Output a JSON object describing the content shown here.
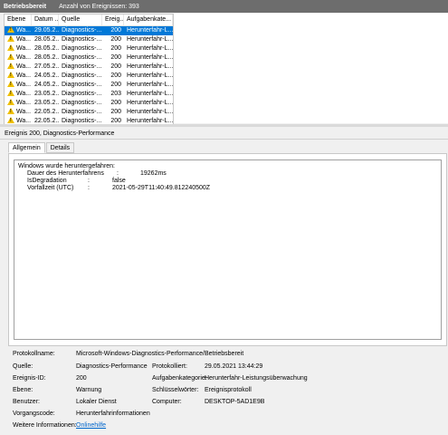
{
  "topbar": {
    "title": "Betriebsbereit",
    "count_label": "Anzahl von Ereignissen: 393"
  },
  "list": {
    "columns": [
      "Ebene",
      "Datum ...",
      "Quelle",
      "Ereig...",
      "Aufgabenkate..."
    ],
    "rows": [
      {
        "level": "Wa...",
        "date": "29.05.2...",
        "source": "Diagnostics-...",
        "id": "200",
        "task": "Herunterfahr-L...",
        "selected": true
      },
      {
        "level": "Wa...",
        "date": "28.05.2...",
        "source": "Diagnostics-...",
        "id": "200",
        "task": "Herunterfahr-L..."
      },
      {
        "level": "Wa...",
        "date": "28.05.2...",
        "source": "Diagnostics-...",
        "id": "200",
        "task": "Herunterfahr-L..."
      },
      {
        "level": "Wa...",
        "date": "28.05.2...",
        "source": "Diagnostics-...",
        "id": "200",
        "task": "Herunterfahr-L..."
      },
      {
        "level": "Wa...",
        "date": "27.05.2...",
        "source": "Diagnostics-...",
        "id": "200",
        "task": "Herunterfahr-L..."
      },
      {
        "level": "Wa...",
        "date": "24.05.2...",
        "source": "Diagnostics-...",
        "id": "200",
        "task": "Herunterfahr-L..."
      },
      {
        "level": "Wa...",
        "date": "24.05.2...",
        "source": "Diagnostics-...",
        "id": "200",
        "task": "Herunterfahr-L..."
      },
      {
        "level": "Wa...",
        "date": "23.05.2...",
        "source": "Diagnostics-...",
        "id": "203",
        "task": "Herunterfahr-L..."
      },
      {
        "level": "Wa...",
        "date": "23.05.2...",
        "source": "Diagnostics-...",
        "id": "200",
        "task": "Herunterfahr-L..."
      },
      {
        "level": "Wa...",
        "date": "22.05.2...",
        "source": "Diagnostics-...",
        "id": "200",
        "task": "Herunterfahr-L..."
      },
      {
        "level": "Wa...",
        "date": "22.05.2...",
        "source": "Diagnostics-...",
        "id": "200",
        "task": "Herunterfahr-L..."
      }
    ]
  },
  "event_title": "Ereignis 200, Diagnostics-Performance",
  "tabs": {
    "general": "Allgemein",
    "details": "Details"
  },
  "description": {
    "line1": "Windows wurde heruntergefahren:",
    "l2_label": "Dauer des Herunterfahrens",
    "l2_sep": ":",
    "l2_val": "19262ms",
    "l3_label": "IsDegradation",
    "l3_sep": ":",
    "l3_val": "false",
    "l4_label": "Vorfallzeit (UTC)",
    "l4_sep": ":",
    "l4_val": "2021-05-29T11:40:49.812240500Z"
  },
  "details": {
    "log_label": "Protokollname:",
    "log_value": "Microsoft-Windows-Diagnostics-Performance/Betriebsbereit",
    "source_label": "Quelle:",
    "source_value": "Diagnostics-Performance",
    "logged_label": "Protokolliert:",
    "logged_value": "29.05.2021 13:44:29",
    "eventid_label": "Ereignis-ID:",
    "eventid_value": "200",
    "category_label": "Aufgabenkategorie:",
    "category_value": "Herunterfahr-Leistungsüberwachung",
    "level_label": "Ebene:",
    "level_value": "Warnung",
    "keywords_label": "Schlüsselwörter:",
    "keywords_value": "Ereignisprotokoll",
    "user_label": "Benutzer:",
    "user_value": "Lokaler Dienst",
    "computer_label": "Computer:",
    "computer_value": "DESKTOP-5AD1E9B",
    "opcode_label": "Vorgangscode:",
    "opcode_value": "Herunterfahrinformationen",
    "more_label": "Weitere Informationen:",
    "more_link": "Onlinehilfe"
  }
}
